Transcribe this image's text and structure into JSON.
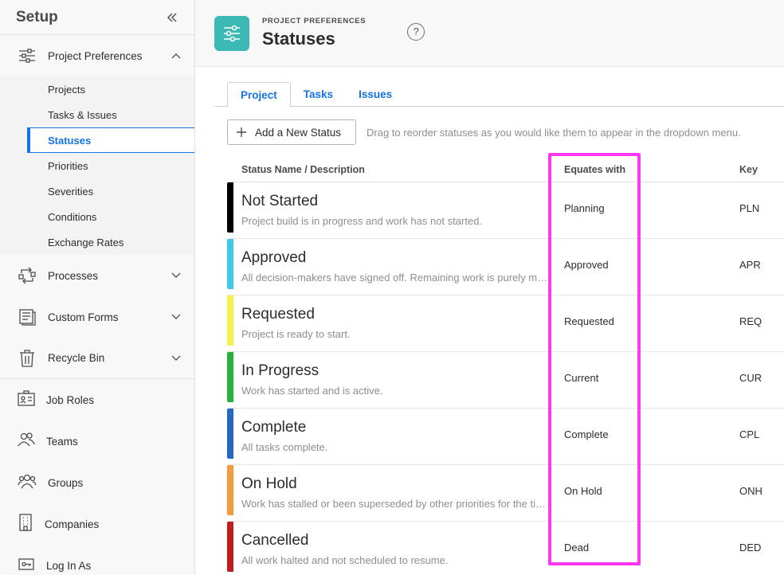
{
  "sidebar": {
    "title": "Setup",
    "groups": {
      "project_preferences": "Project Preferences",
      "processes": "Processes",
      "custom_forms": "Custom Forms",
      "recycle_bin": "Recycle Bin"
    },
    "sub_items": [
      "Projects",
      "Tasks & Issues",
      "Statuses",
      "Priorities",
      "Severities",
      "Conditions",
      "Exchange Rates"
    ],
    "active_sub_item": "Statuses",
    "singles": [
      "Job Roles",
      "Teams",
      "Groups",
      "Companies",
      "Log In As"
    ]
  },
  "header": {
    "eyebrow": "PROJECT PREFERENCES",
    "title": "Statuses",
    "help": "?"
  },
  "tabs": [
    "Project",
    "Tasks",
    "Issues"
  ],
  "active_tab": "Project",
  "toolbar": {
    "add_label": "Add a New Status",
    "hint": "Drag to reorder statuses as you would like them to appear in the dropdown menu."
  },
  "table": {
    "columns": [
      "Status Name / Description",
      "Equates with",
      "Key"
    ],
    "rows": [
      {
        "name": "Not Started",
        "desc": "Project build is in progress and work has not started.",
        "equates": "Planning",
        "key": "PLN",
        "color": "#000000"
      },
      {
        "name": "Approved",
        "desc": "All decision-makers have signed off. Remaining work is purely mechanical.",
        "equates": "Approved",
        "key": "APR",
        "color": "#3ecbe8"
      },
      {
        "name": "Requested",
        "desc": "Project is ready to start.",
        "equates": "Requested",
        "key": "REQ",
        "color": "#f6f04a"
      },
      {
        "name": "In Progress",
        "desc": "Work has started and is active.",
        "equates": "Current",
        "key": "CUR",
        "color": "#27b33a"
      },
      {
        "name": "Complete",
        "desc": "All tasks complete.",
        "equates": "Complete",
        "key": "CPL",
        "color": "#2866c6"
      },
      {
        "name": "On Hold",
        "desc": "Work has stalled or been superseded by other priorities for the time being.",
        "equates": "On Hold",
        "key": "ONH",
        "color": "#f39a3c"
      },
      {
        "name": "Cancelled",
        "desc": "All work halted and not scheduled to resume.",
        "equates": "Dead",
        "key": "DED",
        "color": "#c21c1c"
      }
    ]
  },
  "colors": {
    "accent": "#1473e6",
    "app_icon": "#3db9b5",
    "highlight": "#ff38f2"
  }
}
